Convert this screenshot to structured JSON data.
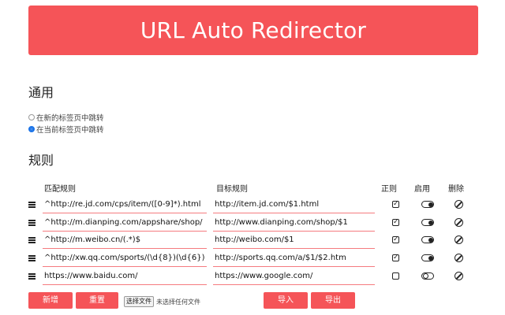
{
  "header": {
    "title": "URL Auto Redirector"
  },
  "general": {
    "title": "通用",
    "options": [
      {
        "label": "在新的标签页中跳转",
        "checked": false
      },
      {
        "label": "在当前标签页中跳转",
        "checked": true
      }
    ]
  },
  "rules": {
    "title": "规则",
    "columns": {
      "from": "匹配规则",
      "to": "目标规则",
      "regex": "正则",
      "enabled": "启用",
      "delete": "删除"
    },
    "rows": [
      {
        "from": "^http://re.jd.com/cps/item/([0-9]*).html",
        "to": "http://item.jd.com/$1.html",
        "regex": true,
        "enabled": true
      },
      {
        "from": "^http://m.dianping.com/appshare/shop/",
        "to": "http://www.dianping.com/shop/$1",
        "regex": true,
        "enabled": true
      },
      {
        "from": "^http://m.weibo.cn/(.*)$",
        "to": "http://weibo.com/$1",
        "regex": true,
        "enabled": true
      },
      {
        "from": "^http://xw.qq.com/sports/(\\d{8})(\\d{6})",
        "to": "http://sports.qq.com/a/$1/$2.htm",
        "regex": true,
        "enabled": true
      },
      {
        "from": "https://www.baidu.com/",
        "to": "https://www.google.com/",
        "regex": false,
        "enabled": false
      }
    ]
  },
  "footer": {
    "add_label": "新增",
    "reset_label": "重置",
    "file_button_label": "选择文件",
    "file_status": "未选择任何文件",
    "import_label": "导入",
    "export_label": "导出"
  },
  "colors": {
    "accent": "#f55458",
    "field_underline": "#f57b7f",
    "radio_checked": "#1a73e8"
  }
}
